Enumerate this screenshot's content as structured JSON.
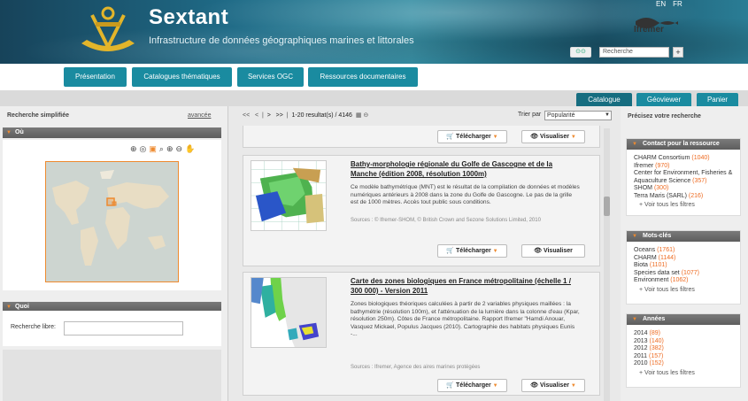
{
  "header": {
    "title": "Sextant",
    "subtitle": "Infrastructure de données géographiques marines et littorales",
    "lang": [
      "EN",
      "FR"
    ],
    "partner": "Ifremer",
    "search_placeholder": "Recherche",
    "search_go": "+"
  },
  "nav": [
    "Présentation",
    "Catalogues thématiques",
    "Services OGC",
    "Ressources documentaires"
  ],
  "tabs": [
    {
      "label": "Catalogue",
      "active": true
    },
    {
      "label": "Géoviewer",
      "active": false
    },
    {
      "label": "Panier",
      "active": false
    }
  ],
  "left": {
    "heading": "Recherche simplifiée",
    "advanced": "avancée",
    "where": "Où",
    "what": "Quoi",
    "free_label": "Recherche libre:"
  },
  "pager": {
    "first": "<<",
    "prev": "<",
    "sep": "|",
    "next": ">",
    "last": ">>",
    "summary": "1-20 resultat(s) / 4146"
  },
  "sort": {
    "label": "Trier par",
    "value": "Popularité"
  },
  "results": [
    {
      "title": "Bathy-morphologie régionale du Golfe de Gascogne et de la Manche (édition 2008, résolution 1000m)",
      "desc": "Ce modèle bathymétrique (MNT) est le résultat de la compilation de données et modèles numériques antérieurs à 2008 dans la zone du Golfe de Gascogne. Le pas de la grille est de 1000 mètres. Accès tout public sous conditions.",
      "source": "Sources : © Ifremer-SHOM, © British Crown and Sezone Solutions Limited, 2010",
      "download": "Télécharger",
      "view": "Visualiser"
    },
    {
      "title": "Carte des zones biologiques en France métropolitaine (échelle 1 / 300 000) - Version 2011",
      "desc": "Zones biologiques théoriques calculées à partir de 2 variables physiques maillées : la bathymétrie (résolution 100m), et l'atténuation de la lumière dans la colonne d'eau (Kpar, résolution 250m). Côtes de France métropolitaine. Rapport Ifremer \"Hamdi Anouar, Vasquez Mickael, Populus Jacques (2010). Cartographie des habitats physiques Eunis -...",
      "source": "Sources : Ifremer, Agence des aires marines protégées",
      "download": "Télécharger",
      "view": "Visualiser"
    }
  ],
  "top_buttons": {
    "download": "Télécharger",
    "view": "Visualiser"
  },
  "right": {
    "heading": "Précisez votre recherche",
    "facets": [
      {
        "title": "Contact pour la ressource",
        "items": [
          {
            "name": "CHARM Consortium",
            "count": "(1040)"
          },
          {
            "name": "Ifremer",
            "count": "(970)"
          },
          {
            "name": "Center for Environment, Fisheries & Aquaculture Science",
            "count": "(357)"
          },
          {
            "name": "SHOM",
            "count": "(300)"
          },
          {
            "name": "Terra Maris (SARL)",
            "count": "(216)"
          }
        ],
        "more": "+ Voir tous les filtres"
      },
      {
        "title": "Mots-clés",
        "items": [
          {
            "name": "Oceans",
            "count": "(1761)"
          },
          {
            "name": "CHARM",
            "count": "(1144)"
          },
          {
            "name": "Biota",
            "count": "(1101)"
          },
          {
            "name": "Species data set",
            "count": "(1077)"
          },
          {
            "name": "Environment",
            "count": "(1062)"
          }
        ],
        "more": "+ Voir tous les filtres"
      },
      {
        "title": "Années",
        "items": [
          {
            "name": "2014",
            "count": "(89)"
          },
          {
            "name": "2013",
            "count": "(140)"
          },
          {
            "name": "2012",
            "count": "(382)"
          },
          {
            "name": "2011",
            "count": "(157)"
          },
          {
            "name": "2010",
            "count": "(152)"
          }
        ],
        "more": "+ Voir tous les filtres"
      }
    ]
  },
  "colors": {
    "nav": "#1a8ba0",
    "tab_active": "#166d80",
    "tab": "#1a8ba0",
    "accent": "#ee8a2f"
  }
}
